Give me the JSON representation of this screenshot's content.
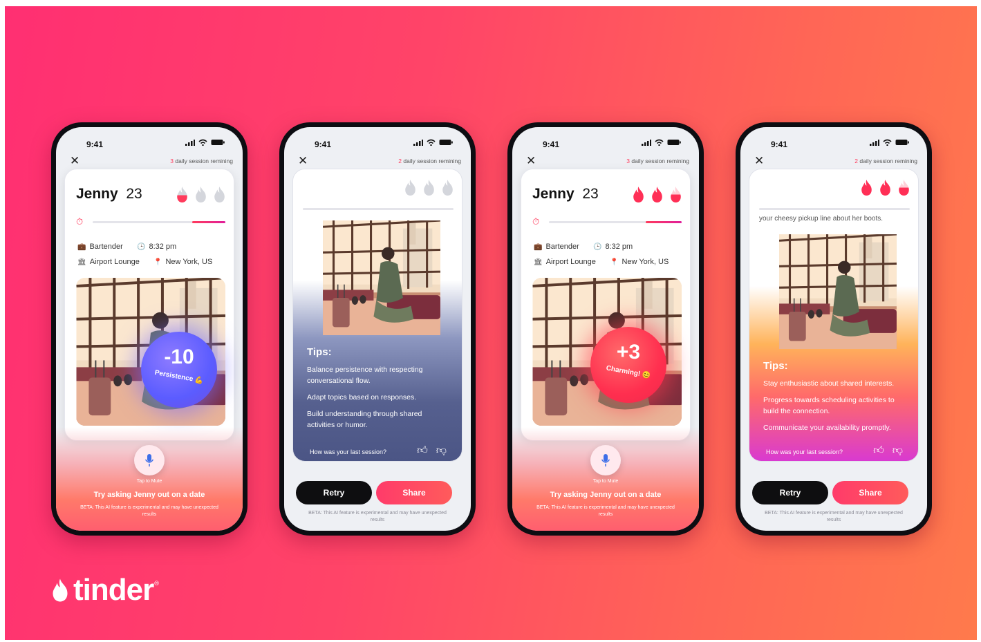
{
  "brand": {
    "name": "tinder",
    "registered": "®",
    "colors": {
      "gradient_start": "#ff2f72",
      "gradient_end": "#ff7a4c",
      "accent": "#ff3b5c"
    }
  },
  "phones": [
    {
      "status_time": "9:41",
      "sessions_count": "3",
      "sessions_label": "daily session remining",
      "name": "Jenny",
      "age": "23",
      "job": "Bartender",
      "time": "8:32 pm",
      "place": "Airport Lounge",
      "location": "New York, US",
      "score_value": "-10",
      "score_label": "Persistence 💪",
      "mic_label": "Tap to Mute",
      "prompt": "Try asking Jenny out on a date",
      "beta": "BETA: This AI feature is experimental and may have unexpected results"
    },
    {
      "status_time": "9:41",
      "sessions_count": "2",
      "sessions_label": "daily session remining",
      "tips_title": "Tips:",
      "tips": [
        "Balance persistence with respecting conversational flow.",
        "Adapt topics based on responses.",
        "Build understanding through shared activities or humor."
      ],
      "feedback_question": "How was your last session?",
      "retry_label": "Retry",
      "share_label": "Share",
      "beta": "BETA: This AI feature is experimental and may have unexpected results"
    },
    {
      "status_time": "9:41",
      "sessions_count": "3",
      "sessions_label": "daily session remining",
      "name": "Jenny",
      "age": "23",
      "job": "Bartender",
      "time": "8:32 pm",
      "place": "Airport Lounge",
      "location": "New York, US",
      "score_value": "+3",
      "score_label": "Charming! 😊",
      "mic_label": "Tap to Mute",
      "prompt": "Try asking Jenny out on a date",
      "beta": "BETA: This AI feature is experimental and may have unexpected results"
    },
    {
      "status_time": "9:41",
      "sessions_count": "2",
      "sessions_label": "daily session remining",
      "snippet": "your cheesy pickup line about her boots.",
      "tips_title": "Tips:",
      "tips": [
        "Stay enthusiastic about shared interests.",
        "Progress towards scheduling activities to build the connection.",
        "Communicate your availability promptly."
      ],
      "feedback_question": "How was your last session?",
      "retry_label": "Retry",
      "share_label": "Share",
      "beta": "BETA: This AI feature is experimental and may have unexpected results"
    }
  ],
  "icons": [
    "close-icon",
    "wifi-icon",
    "battery-icon",
    "signal-icon",
    "flame-icon",
    "timer-icon",
    "briefcase-icon",
    "clock-icon",
    "building-icon",
    "pin-icon",
    "microphone-icon",
    "thumbs-up-icon",
    "thumbs-down-icon",
    "tinder-flame-logo"
  ]
}
